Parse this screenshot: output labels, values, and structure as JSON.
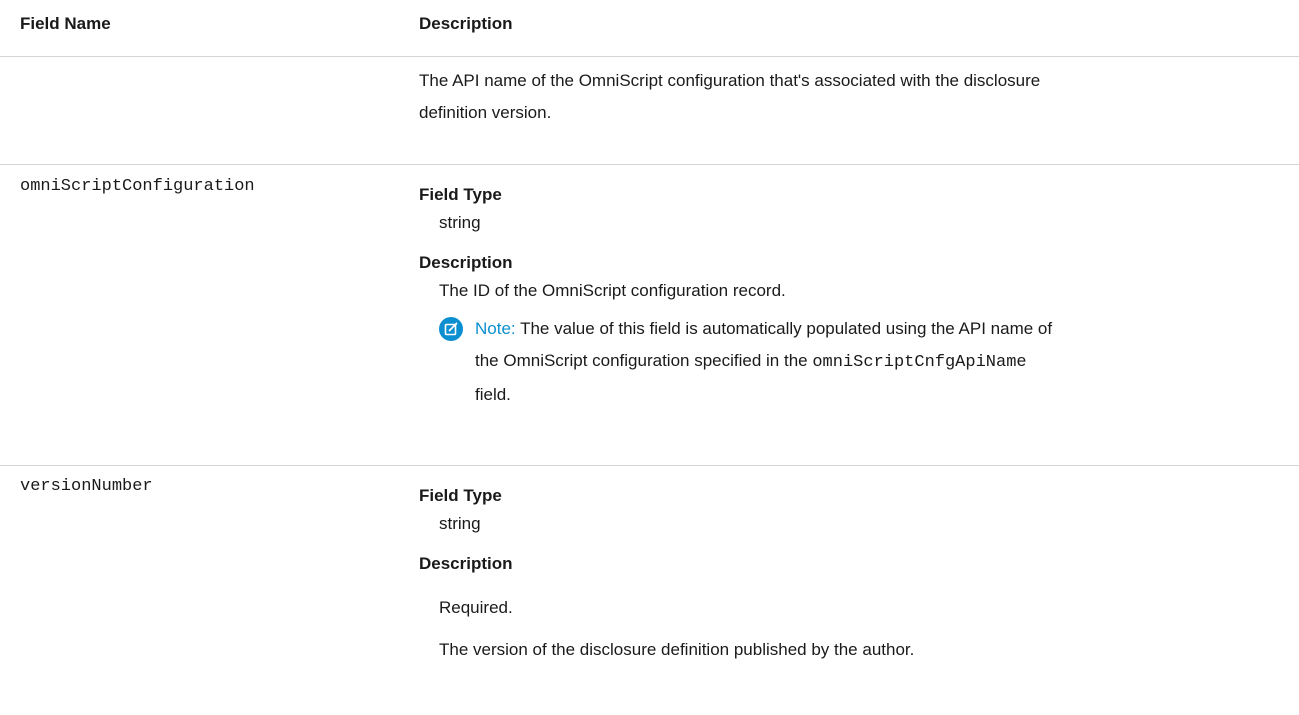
{
  "headers": {
    "field_name": "Field Name",
    "description": "Description"
  },
  "row0": {
    "description_text_line1": "The API name of the OmniScript configuration that's associated with the disclosure",
    "description_text_line2": "definition version."
  },
  "row1": {
    "field": "omniScriptConfiguration",
    "field_type_label": "Field Type",
    "field_type_value": "string",
    "description_label": "Description",
    "description_value": "The ID of the OmniScript configuration record.",
    "note_label": "Note:",
    "note_text_1": "The value of this field is automatically populated using the API name of",
    "note_text_2a": "the OmniScript configuration specified in the",
    "note_code": "omniScriptCnfgApiName",
    "note_text_3": "field."
  },
  "row2": {
    "field": "versionNumber",
    "field_type_label": "Field Type",
    "field_type_value": "string",
    "description_label": "Description",
    "required": "Required.",
    "description_value": "The version of the disclosure definition published by the author."
  },
  "colors": {
    "note_accent": "#0b8fd0",
    "divider": "#d4d4d4"
  },
  "icons": {
    "note": "edit-note-icon"
  }
}
